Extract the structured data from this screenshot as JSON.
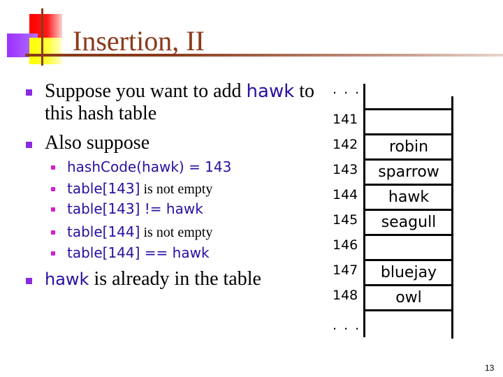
{
  "slide": {
    "title": "Insertion, II",
    "page_number": "13"
  },
  "bullets": {
    "b1_pre": "Suppose you want to add ",
    "b1_code": "hawk",
    "b1_post": " to",
    "b1_line2": "this hash table",
    "b2": "Also suppose",
    "sub": [
      {
        "code": "hashCode(hawk) = 143",
        "rest": ""
      },
      {
        "code": "table[143]",
        "rest": " is not empty"
      },
      {
        "code": "table[143] != hawk",
        "rest": ""
      },
      {
        "code": "table[144]",
        "rest": " is not empty"
      },
      {
        "code": "table[144] == hawk",
        "rest": ""
      }
    ],
    "b3_code": "hawk",
    "b3_rest": " is already in the table"
  },
  "hash_table": {
    "top_ellipsis": ". . .",
    "bottom_ellipsis": ". . .",
    "rows": [
      {
        "index": "141",
        "value": ""
      },
      {
        "index": "142",
        "value": "robin"
      },
      {
        "index": "143",
        "value": "sparrow"
      },
      {
        "index": "144",
        "value": "hawk"
      },
      {
        "index": "145",
        "value": "seagull"
      },
      {
        "index": "146",
        "value": ""
      },
      {
        "index": "147",
        "value": "bluejay"
      },
      {
        "index": "148",
        "value": "owl"
      }
    ]
  },
  "colors": {
    "title": "#8b3a1a",
    "code": "#2a0fa0",
    "bullet_main": "#8a2be2",
    "bullet_sub": "#d21fd2"
  }
}
